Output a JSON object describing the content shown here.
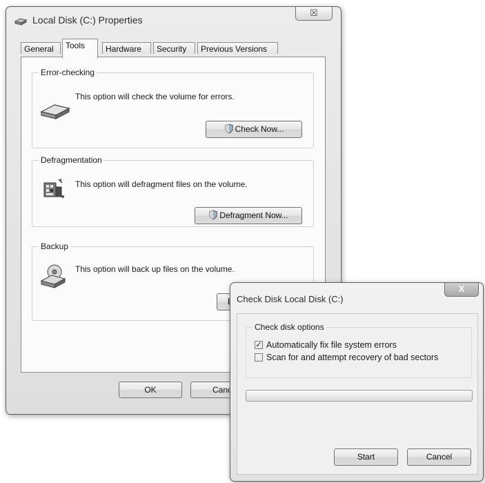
{
  "properties": {
    "title": "Local Disk (C:) Properties",
    "close_glyph": "☒",
    "tabs": [
      {
        "label": "General"
      },
      {
        "label": "Tools"
      },
      {
        "label": "Hardware"
      },
      {
        "label": "Security"
      },
      {
        "label": "Previous Versions"
      }
    ],
    "active_tab": "Tools",
    "error_checking": {
      "label": "Error-checking",
      "description": "This option will check the volume for errors.",
      "button": "Check Now...",
      "icon": "hard-drive-icon"
    },
    "defrag": {
      "label": "Defragmentation",
      "description": "This option will defragment files on the volume.",
      "button": "Defragment Now...",
      "icon": "defrag-icon"
    },
    "backup": {
      "label": "Backup",
      "description": "This option will back up files on the volume.",
      "button": "B",
      "icon": "backup-icon"
    },
    "ok": "OK",
    "cancel": "Canc"
  },
  "check_disk": {
    "title": "Check Disk Local Disk (C:)",
    "close_glyph": "X",
    "options_label": "Check disk options",
    "options": [
      {
        "label": "Automatically fix file system errors",
        "checked": true
      },
      {
        "label": "Scan for and attempt recovery of bad sectors",
        "checked": false
      }
    ],
    "progress": 0,
    "start": "Start",
    "cancel": "Cancel"
  },
  "colors": {
    "accent_shield": "#4a6b9a",
    "window_frame": "#5e5e5e"
  }
}
